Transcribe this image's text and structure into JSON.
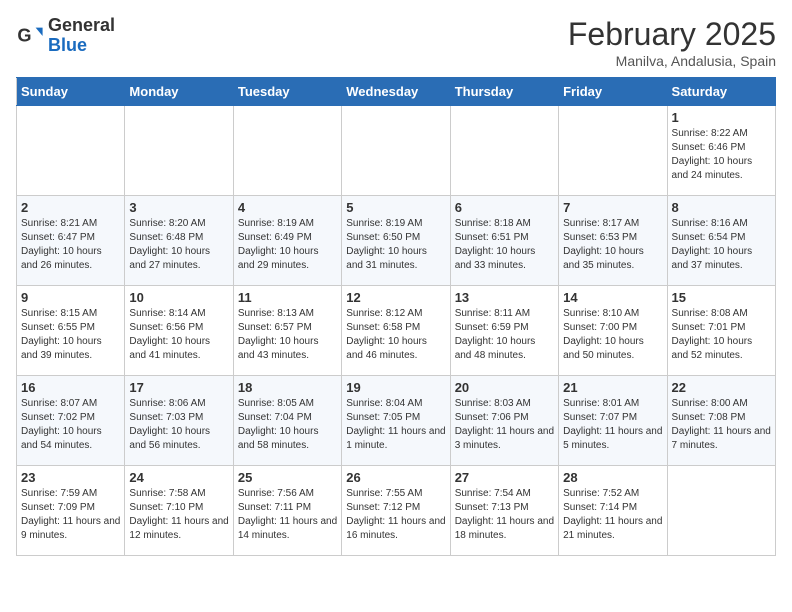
{
  "header": {
    "logo_general": "General",
    "logo_blue": "Blue",
    "month_title": "February 2025",
    "location": "Manilva, Andalusia, Spain"
  },
  "days_of_week": [
    "Sunday",
    "Monday",
    "Tuesday",
    "Wednesday",
    "Thursday",
    "Friday",
    "Saturday"
  ],
  "weeks": [
    [
      {
        "num": "",
        "info": ""
      },
      {
        "num": "",
        "info": ""
      },
      {
        "num": "",
        "info": ""
      },
      {
        "num": "",
        "info": ""
      },
      {
        "num": "",
        "info": ""
      },
      {
        "num": "",
        "info": ""
      },
      {
        "num": "1",
        "info": "Sunrise: 8:22 AM\nSunset: 6:46 PM\nDaylight: 10 hours and 24 minutes."
      }
    ],
    [
      {
        "num": "2",
        "info": "Sunrise: 8:21 AM\nSunset: 6:47 PM\nDaylight: 10 hours and 26 minutes."
      },
      {
        "num": "3",
        "info": "Sunrise: 8:20 AM\nSunset: 6:48 PM\nDaylight: 10 hours and 27 minutes."
      },
      {
        "num": "4",
        "info": "Sunrise: 8:19 AM\nSunset: 6:49 PM\nDaylight: 10 hours and 29 minutes."
      },
      {
        "num": "5",
        "info": "Sunrise: 8:19 AM\nSunset: 6:50 PM\nDaylight: 10 hours and 31 minutes."
      },
      {
        "num": "6",
        "info": "Sunrise: 8:18 AM\nSunset: 6:51 PM\nDaylight: 10 hours and 33 minutes."
      },
      {
        "num": "7",
        "info": "Sunrise: 8:17 AM\nSunset: 6:53 PM\nDaylight: 10 hours and 35 minutes."
      },
      {
        "num": "8",
        "info": "Sunrise: 8:16 AM\nSunset: 6:54 PM\nDaylight: 10 hours and 37 minutes."
      }
    ],
    [
      {
        "num": "9",
        "info": "Sunrise: 8:15 AM\nSunset: 6:55 PM\nDaylight: 10 hours and 39 minutes."
      },
      {
        "num": "10",
        "info": "Sunrise: 8:14 AM\nSunset: 6:56 PM\nDaylight: 10 hours and 41 minutes."
      },
      {
        "num": "11",
        "info": "Sunrise: 8:13 AM\nSunset: 6:57 PM\nDaylight: 10 hours and 43 minutes."
      },
      {
        "num": "12",
        "info": "Sunrise: 8:12 AM\nSunset: 6:58 PM\nDaylight: 10 hours and 46 minutes."
      },
      {
        "num": "13",
        "info": "Sunrise: 8:11 AM\nSunset: 6:59 PM\nDaylight: 10 hours and 48 minutes."
      },
      {
        "num": "14",
        "info": "Sunrise: 8:10 AM\nSunset: 7:00 PM\nDaylight: 10 hours and 50 minutes."
      },
      {
        "num": "15",
        "info": "Sunrise: 8:08 AM\nSunset: 7:01 PM\nDaylight: 10 hours and 52 minutes."
      }
    ],
    [
      {
        "num": "16",
        "info": "Sunrise: 8:07 AM\nSunset: 7:02 PM\nDaylight: 10 hours and 54 minutes."
      },
      {
        "num": "17",
        "info": "Sunrise: 8:06 AM\nSunset: 7:03 PM\nDaylight: 10 hours and 56 minutes."
      },
      {
        "num": "18",
        "info": "Sunrise: 8:05 AM\nSunset: 7:04 PM\nDaylight: 10 hours and 58 minutes."
      },
      {
        "num": "19",
        "info": "Sunrise: 8:04 AM\nSunset: 7:05 PM\nDaylight: 11 hours and 1 minute."
      },
      {
        "num": "20",
        "info": "Sunrise: 8:03 AM\nSunset: 7:06 PM\nDaylight: 11 hours and 3 minutes."
      },
      {
        "num": "21",
        "info": "Sunrise: 8:01 AM\nSunset: 7:07 PM\nDaylight: 11 hours and 5 minutes."
      },
      {
        "num": "22",
        "info": "Sunrise: 8:00 AM\nSunset: 7:08 PM\nDaylight: 11 hours and 7 minutes."
      }
    ],
    [
      {
        "num": "23",
        "info": "Sunrise: 7:59 AM\nSunset: 7:09 PM\nDaylight: 11 hours and 9 minutes."
      },
      {
        "num": "24",
        "info": "Sunrise: 7:58 AM\nSunset: 7:10 PM\nDaylight: 11 hours and 12 minutes."
      },
      {
        "num": "25",
        "info": "Sunrise: 7:56 AM\nSunset: 7:11 PM\nDaylight: 11 hours and 14 minutes."
      },
      {
        "num": "26",
        "info": "Sunrise: 7:55 AM\nSunset: 7:12 PM\nDaylight: 11 hours and 16 minutes."
      },
      {
        "num": "27",
        "info": "Sunrise: 7:54 AM\nSunset: 7:13 PM\nDaylight: 11 hours and 18 minutes."
      },
      {
        "num": "28",
        "info": "Sunrise: 7:52 AM\nSunset: 7:14 PM\nDaylight: 11 hours and 21 minutes."
      },
      {
        "num": "",
        "info": ""
      }
    ]
  ]
}
